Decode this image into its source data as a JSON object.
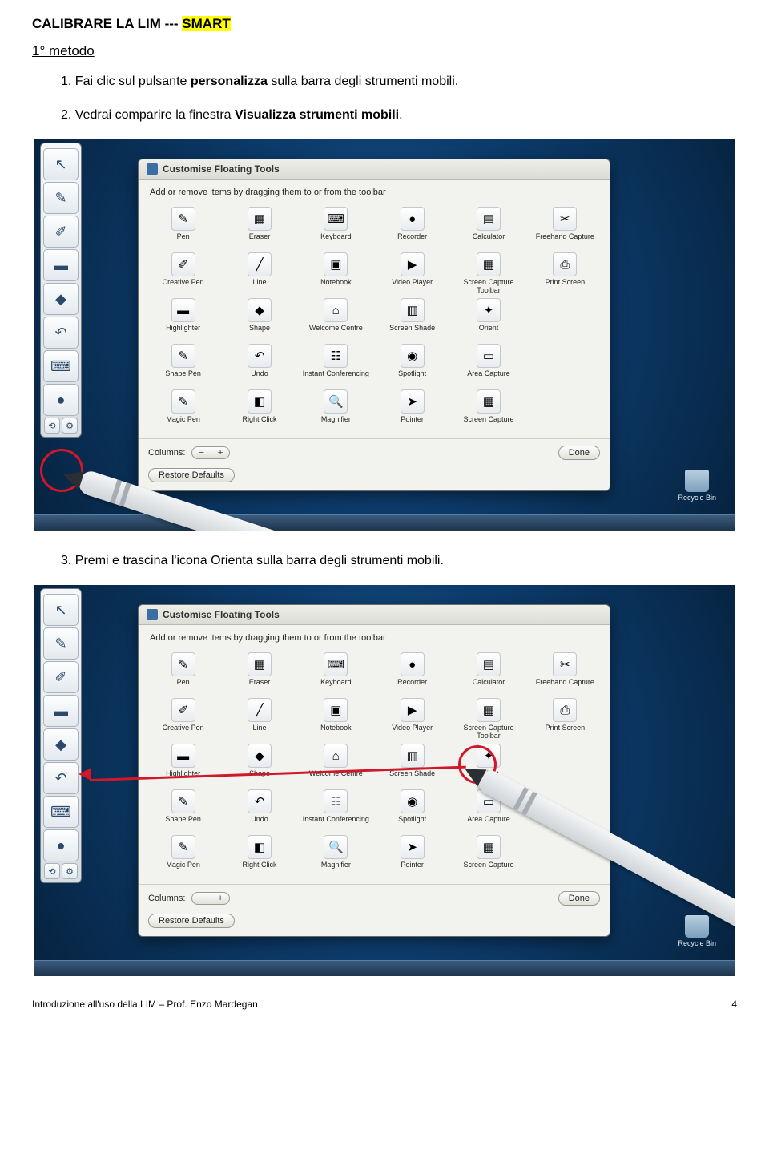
{
  "doc": {
    "title_prefix": "CALIBRARE LA LIM --- ",
    "title_highlight": "SMART",
    "subtitle": "1° metodo",
    "step1_num": "1.",
    "step1_a": "Fai clic sul pulsante ",
    "step1_b": "personalizza",
    "step1_c": " sulla barra degli strumenti mobili.",
    "step2_num": "2.",
    "step2_a": "Vedrai comparire la finestra ",
    "step2_b": "Visualizza strumenti mobili",
    "step2_c": ".",
    "step3_num": "3.",
    "step3_a": "Premi e trascina l'icona Orienta sulla barra degli strumenti mobili.",
    "footer": "Introduzione all'uso della LIM – Prof. Enzo Mardegan",
    "page_number": "4"
  },
  "dialog": {
    "title": "Customise Floating Tools",
    "hint": "Add or remove items by dragging them to or from the toolbar",
    "columns_label": "Columns:",
    "done": "Done",
    "restore": "Restore Defaults"
  },
  "recycle_label": "Recycle Bin",
  "tools": [
    {
      "label": "Pen",
      "glyph": "✎"
    },
    {
      "label": "Eraser",
      "glyph": "▦"
    },
    {
      "label": "Keyboard",
      "glyph": "⌨"
    },
    {
      "label": "Recorder",
      "glyph": "●"
    },
    {
      "label": "Calculator",
      "glyph": "▤"
    },
    {
      "label": "Freehand Capture",
      "glyph": "✂"
    },
    {
      "label": "Creative Pen",
      "glyph": "✐"
    },
    {
      "label": "Line",
      "glyph": "╱"
    },
    {
      "label": "Notebook",
      "glyph": "▣"
    },
    {
      "label": "Video Player",
      "glyph": "▶"
    },
    {
      "label": "Screen Capture Toolbar",
      "glyph": "▦"
    },
    {
      "label": "Print Screen",
      "glyph": "⎙"
    },
    {
      "label": "Highlighter",
      "glyph": "▬"
    },
    {
      "label": "Shape",
      "glyph": "◆"
    },
    {
      "label": "Welcome Centre",
      "glyph": "⌂"
    },
    {
      "label": "Screen Shade",
      "glyph": "▥"
    },
    {
      "label": "Orient",
      "glyph": "✦"
    },
    {
      "label": "",
      "glyph": ""
    },
    {
      "label": "Shape Pen",
      "glyph": "✎"
    },
    {
      "label": "Undo",
      "glyph": "↶"
    },
    {
      "label": "Instant Conferencing",
      "glyph": "☷"
    },
    {
      "label": "Spotlight",
      "glyph": "◉"
    },
    {
      "label": "Area Capture",
      "glyph": "▭"
    },
    {
      "label": "",
      "glyph": ""
    },
    {
      "label": "Magic Pen",
      "glyph": "✎"
    },
    {
      "label": "Right Click",
      "glyph": "◧"
    },
    {
      "label": "Magnifier",
      "glyph": "🔍"
    },
    {
      "label": "Pointer",
      "glyph": "➤"
    },
    {
      "label": "Screen Capture",
      "glyph": "▦"
    },
    {
      "label": "",
      "glyph": ""
    }
  ],
  "fbar_icons": [
    "↖",
    "✎",
    "✐",
    "▬",
    "◆",
    "↶",
    "⌨",
    "●"
  ]
}
